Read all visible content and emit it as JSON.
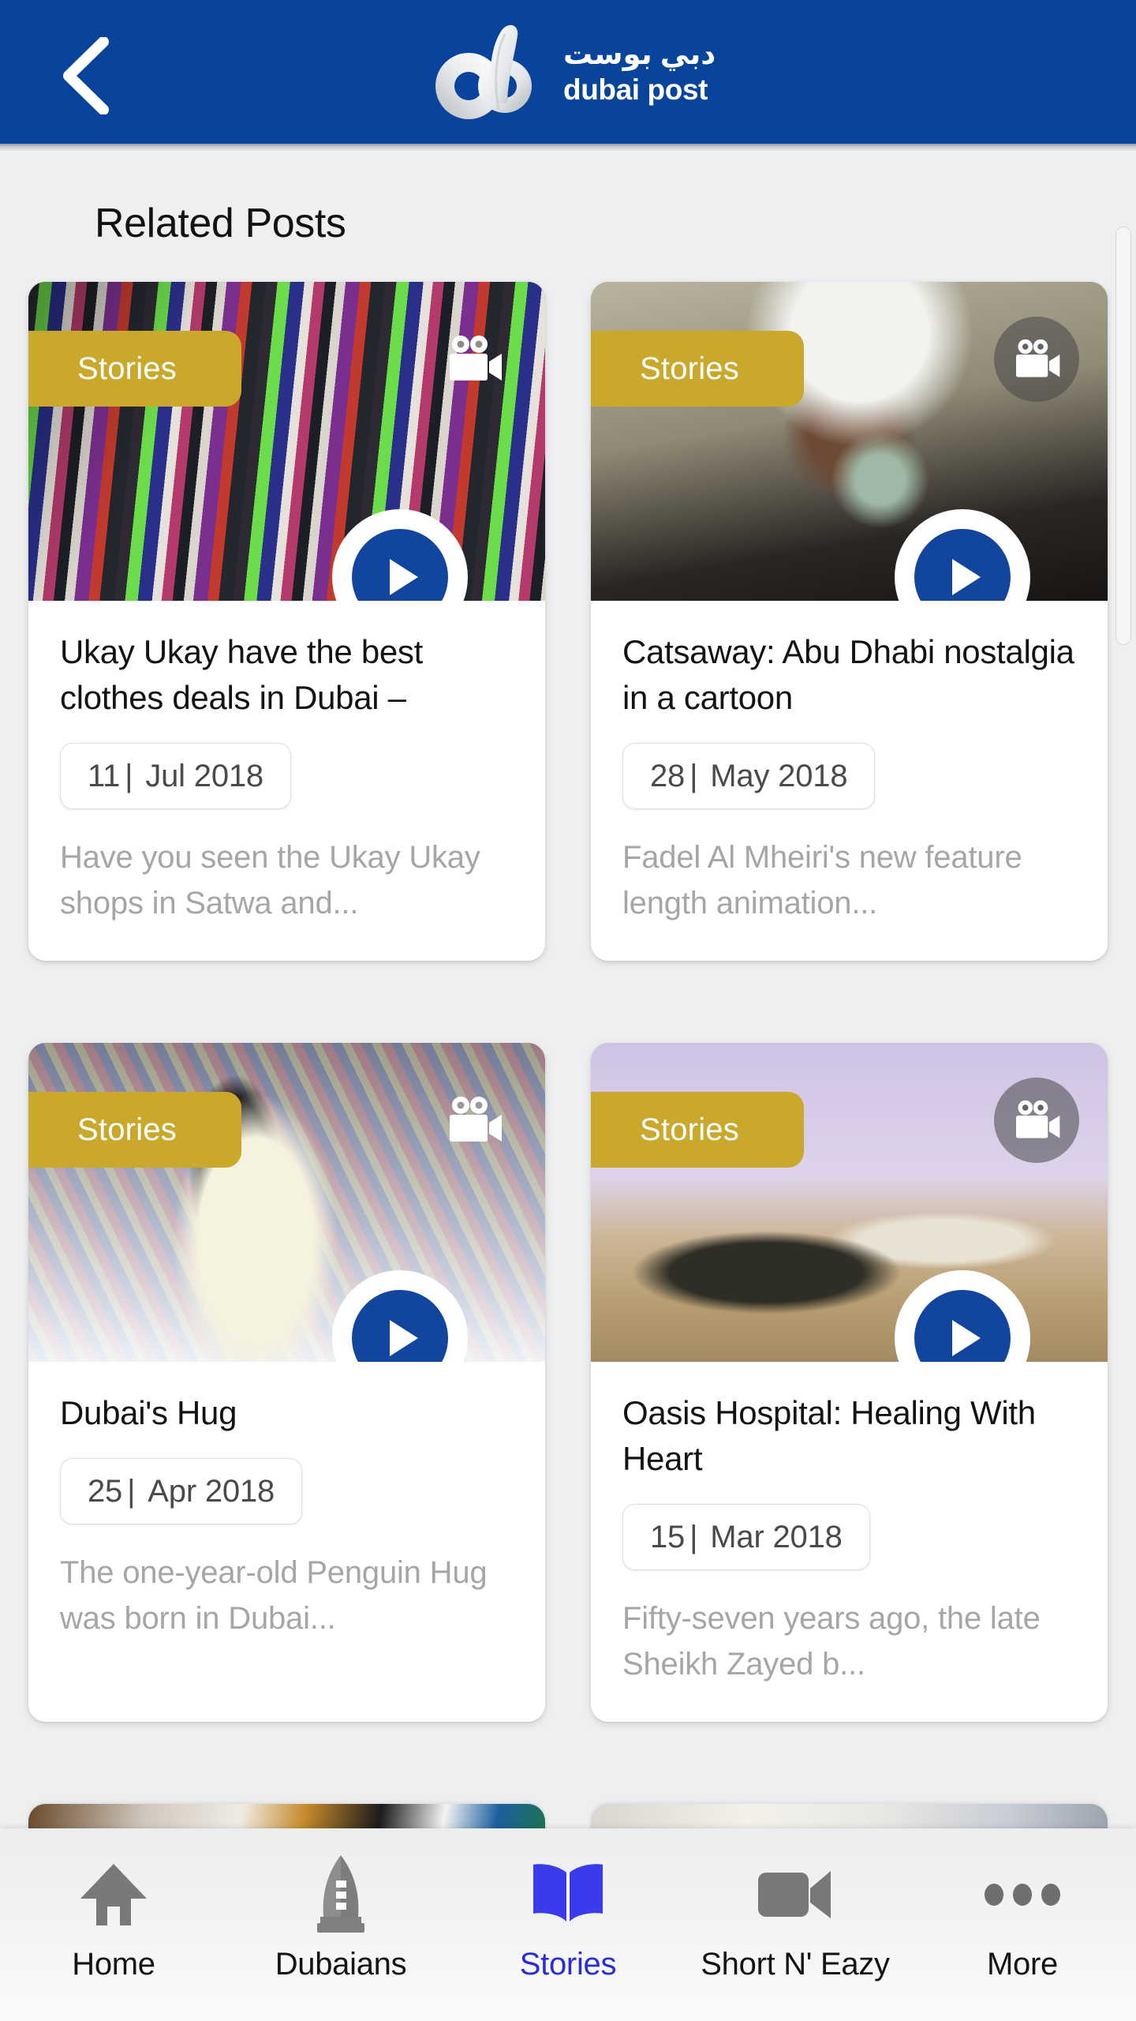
{
  "header": {
    "back_icon": "chevron-left-icon",
    "brand_logo_icon": "dubai-post-logo-icon",
    "brand_name_ar": "دبي بوست",
    "brand_name_en": "dubai post",
    "background_color": "#08439C"
  },
  "page": {
    "title": "Related Posts",
    "background_color": "#EEEFF0"
  },
  "theme": {
    "primary_blue": "#11459E",
    "header_blue": "#08439C",
    "badge_gold": "#C9A82C",
    "active_nav_blue": "#2B2BD8",
    "title_text": "#131313",
    "excerpt_text": "#A6A6A6",
    "date_text": "#4A4A4A"
  },
  "cards": [
    {
      "category": "Stories",
      "title": "Ukay Ukay have the best clothes deals in Dubai –",
      "date_day": "11",
      "date_separator": "|",
      "date_rest": "Jul 2018",
      "excerpt": "Have you seen the Ukay Ukay shops in Satwa and...",
      "media_icon": "movie-camera-icon",
      "media_icon_has_disc": false,
      "play_icon": "play-button-icon",
      "thumbnail_alt": "Hand browsing a rack of colourful secondhand clothes"
    },
    {
      "category": "Stories",
      "title": "Catsaway: Abu Dhabi nostalgia in a cartoon",
      "date_day": "28",
      "date_separator": "|",
      "date_rest": "May 2018",
      "excerpt": "Fadel Al Mheiri's new feature length animation...",
      "media_icon": "movie-camera-icon",
      "media_icon_has_disc": true,
      "play_icon": "play-button-icon",
      "thumbnail_alt": "Emirati man in kandura holding a small cat figurine"
    },
    {
      "category": "Stories",
      "title": "Dubai's Hug",
      "date_day": "25",
      "date_separator": "|",
      "date_rest": "Apr 2018",
      "excerpt": "The one-year-old Penguin Hug was born in Dubai...",
      "media_icon": "movie-camera-icon",
      "media_icon_has_disc": false,
      "play_icon": "play-button-icon",
      "thumbnail_alt": "King penguin standing on snow with visitors behind a net"
    },
    {
      "category": "Stories",
      "title": "Oasis Hospital: Healing With Heart",
      "date_day": "15",
      "date_separator": "|",
      "date_rest": "Mar 2018",
      "excerpt": "Fifty-seven years ago, the late Sheikh Zayed b...",
      "media_icon": "movie-camera-icon",
      "media_icon_has_disc": true,
      "play_icon": "play-button-icon",
      "thumbnail_alt": "Bedouin tent and low desert building under a lilac sky"
    }
  ],
  "bottom_nav": {
    "items": [
      {
        "label": "Home",
        "icon": "home-icon",
        "active": false
      },
      {
        "label": "Dubaians",
        "icon": "burj-tower-icon",
        "active": false
      },
      {
        "label": "Stories",
        "icon": "open-book-icon",
        "active": true
      },
      {
        "label": "Short N' Eazy",
        "icon": "video-camera-icon",
        "active": false
      },
      {
        "label": "More",
        "icon": "ellipsis-icon",
        "active": false
      }
    ]
  },
  "scrollbar": {
    "name": "vertical-scrollbar"
  }
}
